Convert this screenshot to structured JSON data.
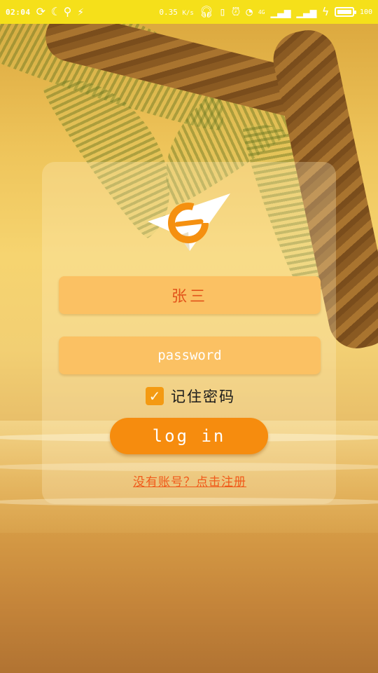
{
  "status_bar": {
    "time": "02:04",
    "net_speed": "0.35",
    "net_speed_unit": "K/s",
    "signal_label": "4G",
    "battery_level": "100",
    "icons": [
      "headset-icon",
      "vibrate-icon",
      "alarm-icon",
      "wifi-icon",
      "signal-icon",
      "charging-icon",
      "battery-icon"
    ]
  },
  "login": {
    "username_value": "张三",
    "password_placeholder": "password",
    "remember_label": "记住密码",
    "remember_checked": true,
    "login_button": "log in",
    "register_link": "没有账号？点击注册"
  },
  "colors": {
    "status_bar": "#f5e01a",
    "field_bg": "#fbc163",
    "button": "#f68c0e",
    "link": "#f05a1a"
  }
}
